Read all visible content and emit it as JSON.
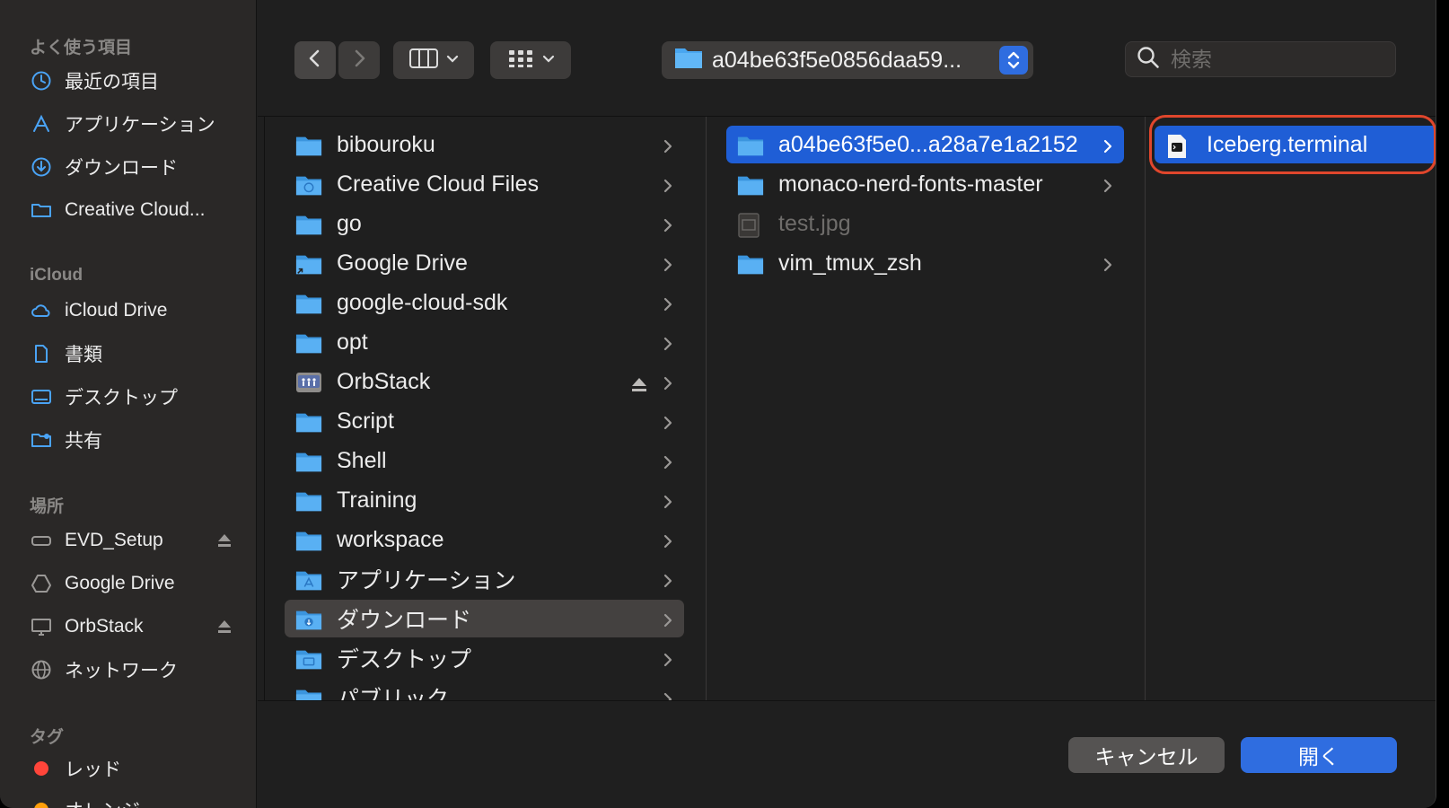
{
  "sidebar": {
    "favorites_heading": "よく使う項目",
    "favorites": [
      {
        "label": "最近の項目",
        "icon": "clock-icon"
      },
      {
        "label": "アプリケーション",
        "icon": "applications-icon"
      },
      {
        "label": "ダウンロード",
        "icon": "download-icon"
      },
      {
        "label": "Creative Cloud...",
        "icon": "folder-icon"
      }
    ],
    "icloud_heading": "iCloud",
    "icloud": [
      {
        "label": "iCloud Drive",
        "icon": "cloud-icon"
      },
      {
        "label": "書類",
        "icon": "document-icon"
      },
      {
        "label": "デスクトップ",
        "icon": "desktop-icon"
      },
      {
        "label": "共有",
        "icon": "shared-folder-icon"
      }
    ],
    "locations_heading": "場所",
    "locations": [
      {
        "label": "EVD_Setup",
        "icon": "drive-icon",
        "eject": true
      },
      {
        "label": "Google Drive",
        "icon": "google-drive-icon",
        "eject": false
      },
      {
        "label": "OrbStack",
        "icon": "monitor-icon",
        "eject": true
      },
      {
        "label": "ネットワーク",
        "icon": "globe-icon",
        "eject": false
      }
    ],
    "tags_heading": "タグ",
    "tags": [
      {
        "label": "レッド",
        "color": "#ff453a"
      },
      {
        "label": "オレンジ",
        "color": "#ff9f0a"
      }
    ]
  },
  "toolbar": {
    "path_label": "a04be63f5e0856daa59...",
    "search_placeholder": "検索"
  },
  "column1": [
    {
      "label": "bibouroku",
      "icon": "folder-icon"
    },
    {
      "label": "Creative Cloud Files",
      "icon": "cc-folder-icon"
    },
    {
      "label": "go",
      "icon": "folder-icon"
    },
    {
      "label": "Google Drive",
      "icon": "alias-folder-icon"
    },
    {
      "label": "google-cloud-sdk",
      "icon": "folder-icon"
    },
    {
      "label": "opt",
      "icon": "folder-icon"
    },
    {
      "label": "OrbStack",
      "icon": "orbstack-volume-icon",
      "eject": true
    },
    {
      "label": "Script",
      "icon": "folder-icon"
    },
    {
      "label": "Shell",
      "icon": "folder-icon"
    },
    {
      "label": "Training",
      "icon": "folder-icon"
    },
    {
      "label": "workspace",
      "icon": "folder-icon"
    },
    {
      "label": "アプリケーション",
      "icon": "applications-folder-icon"
    },
    {
      "label": "ダウンロード",
      "icon": "downloads-folder-icon",
      "selected": true
    },
    {
      "label": "デスクトップ",
      "icon": "desktop-folder-icon"
    },
    {
      "label": "パブリック",
      "icon": "public-folder-icon"
    }
  ],
  "column2": [
    {
      "label": "a04be63f5e0...a28a7e1a2152",
      "icon": "folder-icon",
      "selected": true
    },
    {
      "label": "monaco-nerd-fonts-master",
      "icon": "folder-icon"
    },
    {
      "label": "test.jpg",
      "icon": "image-file-icon",
      "dim": true,
      "file": true
    },
    {
      "label": "vim_tmux_zsh",
      "icon": "folder-icon"
    }
  ],
  "column3": [
    {
      "label": "Iceberg.terminal",
      "icon": "terminal-file-icon",
      "selected": true
    }
  ],
  "footer": {
    "cancel_label": "キャンセル",
    "open_label": "開く"
  },
  "colors": {
    "accent": "#1f5ed6",
    "highlight_ring": "#e0462c",
    "folder": "#49a6f0"
  }
}
